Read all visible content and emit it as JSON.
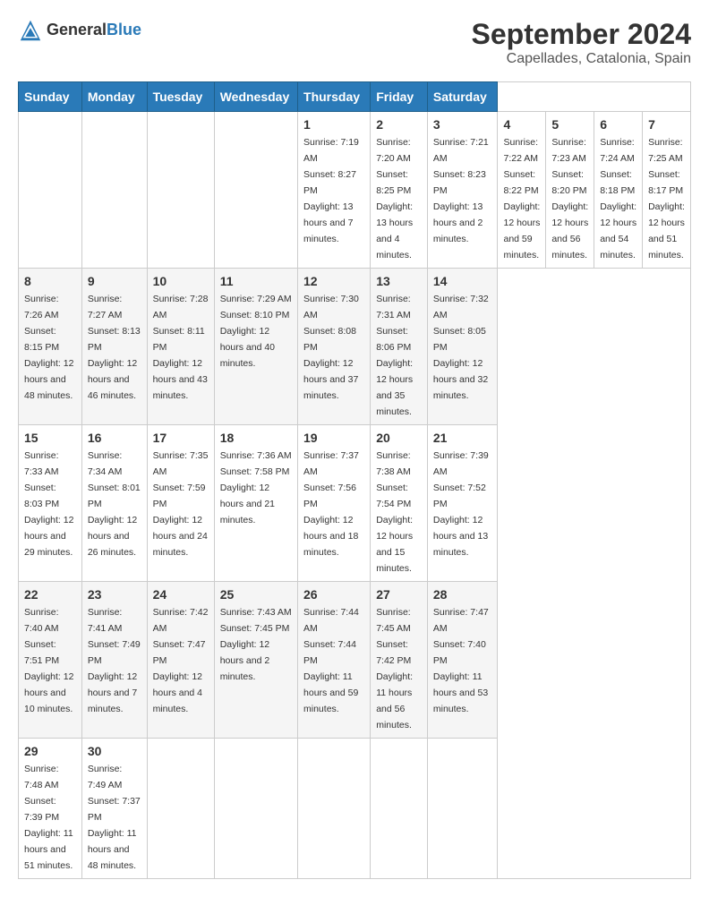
{
  "logo": {
    "general": "General",
    "blue": "Blue"
  },
  "title": "September 2024",
  "subtitle": "Capellades, Catalonia, Spain",
  "calendar": {
    "headers": [
      "Sunday",
      "Monday",
      "Tuesday",
      "Wednesday",
      "Thursday",
      "Friday",
      "Saturday"
    ],
    "weeks": [
      [
        null,
        null,
        null,
        null,
        {
          "day": "1",
          "info": "Sunrise: 7:19 AM\nSunset: 8:27 PM\nDaylight: 13 hours and 7 minutes."
        },
        {
          "day": "2",
          "info": "Sunrise: 7:20 AM\nSunset: 8:25 PM\nDaylight: 13 hours and 4 minutes."
        },
        {
          "day": "3",
          "info": "Sunrise: 7:21 AM\nSunset: 8:23 PM\nDaylight: 13 hours and 2 minutes."
        },
        {
          "day": "4",
          "info": "Sunrise: 7:22 AM\nSunset: 8:22 PM\nDaylight: 12 hours and 59 minutes."
        },
        {
          "day": "5",
          "info": "Sunrise: 7:23 AM\nSunset: 8:20 PM\nDaylight: 12 hours and 56 minutes."
        },
        {
          "day": "6",
          "info": "Sunrise: 7:24 AM\nSunset: 8:18 PM\nDaylight: 12 hours and 54 minutes."
        },
        {
          "day": "7",
          "info": "Sunrise: 7:25 AM\nSunset: 8:17 PM\nDaylight: 12 hours and 51 minutes."
        }
      ],
      [
        {
          "day": "8",
          "info": "Sunrise: 7:26 AM\nSunset: 8:15 PM\nDaylight: 12 hours and 48 minutes."
        },
        {
          "day": "9",
          "info": "Sunrise: 7:27 AM\nSunset: 8:13 PM\nDaylight: 12 hours and 46 minutes."
        },
        {
          "day": "10",
          "info": "Sunrise: 7:28 AM\nSunset: 8:11 PM\nDaylight: 12 hours and 43 minutes."
        },
        {
          "day": "11",
          "info": "Sunrise: 7:29 AM\nSunset: 8:10 PM\nDaylight: 12 hours and 40 minutes."
        },
        {
          "day": "12",
          "info": "Sunrise: 7:30 AM\nSunset: 8:08 PM\nDaylight: 12 hours and 37 minutes."
        },
        {
          "day": "13",
          "info": "Sunrise: 7:31 AM\nSunset: 8:06 PM\nDaylight: 12 hours and 35 minutes."
        },
        {
          "day": "14",
          "info": "Sunrise: 7:32 AM\nSunset: 8:05 PM\nDaylight: 12 hours and 32 minutes."
        }
      ],
      [
        {
          "day": "15",
          "info": "Sunrise: 7:33 AM\nSunset: 8:03 PM\nDaylight: 12 hours and 29 minutes."
        },
        {
          "day": "16",
          "info": "Sunrise: 7:34 AM\nSunset: 8:01 PM\nDaylight: 12 hours and 26 minutes."
        },
        {
          "day": "17",
          "info": "Sunrise: 7:35 AM\nSunset: 7:59 PM\nDaylight: 12 hours and 24 minutes."
        },
        {
          "day": "18",
          "info": "Sunrise: 7:36 AM\nSunset: 7:58 PM\nDaylight: 12 hours and 21 minutes."
        },
        {
          "day": "19",
          "info": "Sunrise: 7:37 AM\nSunset: 7:56 PM\nDaylight: 12 hours and 18 minutes."
        },
        {
          "day": "20",
          "info": "Sunrise: 7:38 AM\nSunset: 7:54 PM\nDaylight: 12 hours and 15 minutes."
        },
        {
          "day": "21",
          "info": "Sunrise: 7:39 AM\nSunset: 7:52 PM\nDaylight: 12 hours and 13 minutes."
        }
      ],
      [
        {
          "day": "22",
          "info": "Sunrise: 7:40 AM\nSunset: 7:51 PM\nDaylight: 12 hours and 10 minutes."
        },
        {
          "day": "23",
          "info": "Sunrise: 7:41 AM\nSunset: 7:49 PM\nDaylight: 12 hours and 7 minutes."
        },
        {
          "day": "24",
          "info": "Sunrise: 7:42 AM\nSunset: 7:47 PM\nDaylight: 12 hours and 4 minutes."
        },
        {
          "day": "25",
          "info": "Sunrise: 7:43 AM\nSunset: 7:45 PM\nDaylight: 12 hours and 2 minutes."
        },
        {
          "day": "26",
          "info": "Sunrise: 7:44 AM\nSunset: 7:44 PM\nDaylight: 11 hours and 59 minutes."
        },
        {
          "day": "27",
          "info": "Sunrise: 7:45 AM\nSunset: 7:42 PM\nDaylight: 11 hours and 56 minutes."
        },
        {
          "day": "28",
          "info": "Sunrise: 7:47 AM\nSunset: 7:40 PM\nDaylight: 11 hours and 53 minutes."
        }
      ],
      [
        {
          "day": "29",
          "info": "Sunrise: 7:48 AM\nSunset: 7:39 PM\nDaylight: 11 hours and 51 minutes."
        },
        {
          "day": "30",
          "info": "Sunrise: 7:49 AM\nSunset: 7:37 PM\nDaylight: 11 hours and 48 minutes."
        },
        null,
        null,
        null,
        null,
        null
      ]
    ]
  }
}
